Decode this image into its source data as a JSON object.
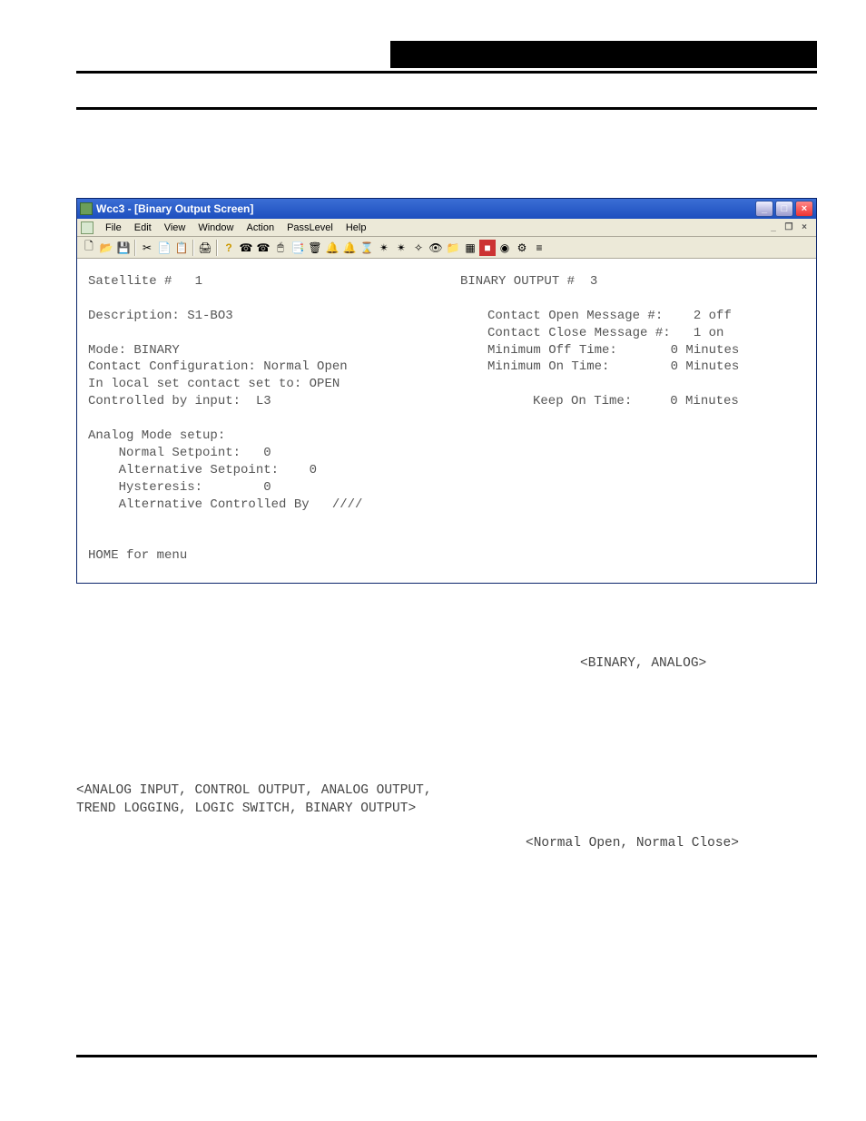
{
  "app": {
    "title": "Wcc3 - [Binary Output Screen]"
  },
  "menubar": {
    "items": [
      "File",
      "Edit",
      "View",
      "Window",
      "Action",
      "PassLevel",
      "Help"
    ]
  },
  "screen": {
    "satellite_label": "Satellite #   1",
    "binary_output_label": "BINARY OUTPUT #  3",
    "description_label": "Description: S1-BO3",
    "mode_label": "Mode: BINARY",
    "contact_config_label": "Contact Configuration: Normal Open",
    "local_set_label": "In local set contact set to: OPEN",
    "controlled_by_label": "Controlled by input:  L3",
    "contact_open_msg": "Contact Open Message #:    2 off",
    "contact_close_msg": "Contact Close Message #:   1 on",
    "min_off_time": "Minimum Off Time:       0 Minutes",
    "min_on_time": "Minimum On Time:        0 Minutes",
    "keep_on_time": "Keep On Time:     0 Minutes",
    "analog_setup": "Analog Mode setup:",
    "normal_setpoint": "    Normal Setpoint:   0",
    "alt_setpoint": "    Alternative Setpoint:    0",
    "hysteresis": "    Hysteresis:        0",
    "alt_controlled_by": "    Alternative Controlled By   ////",
    "home_hint": "HOME for menu"
  },
  "body": {
    "opts1": "<BINARY, ANALOG>",
    "opts2a": "<ANALOG INPUT, CONTROL OUTPUT, ANALOG OUTPUT,",
    "opts2b": " TREND LOGGING, LOGIC SWITCH, BINARY OUTPUT>",
    "opts3": "<Normal Open, Normal Close>"
  }
}
